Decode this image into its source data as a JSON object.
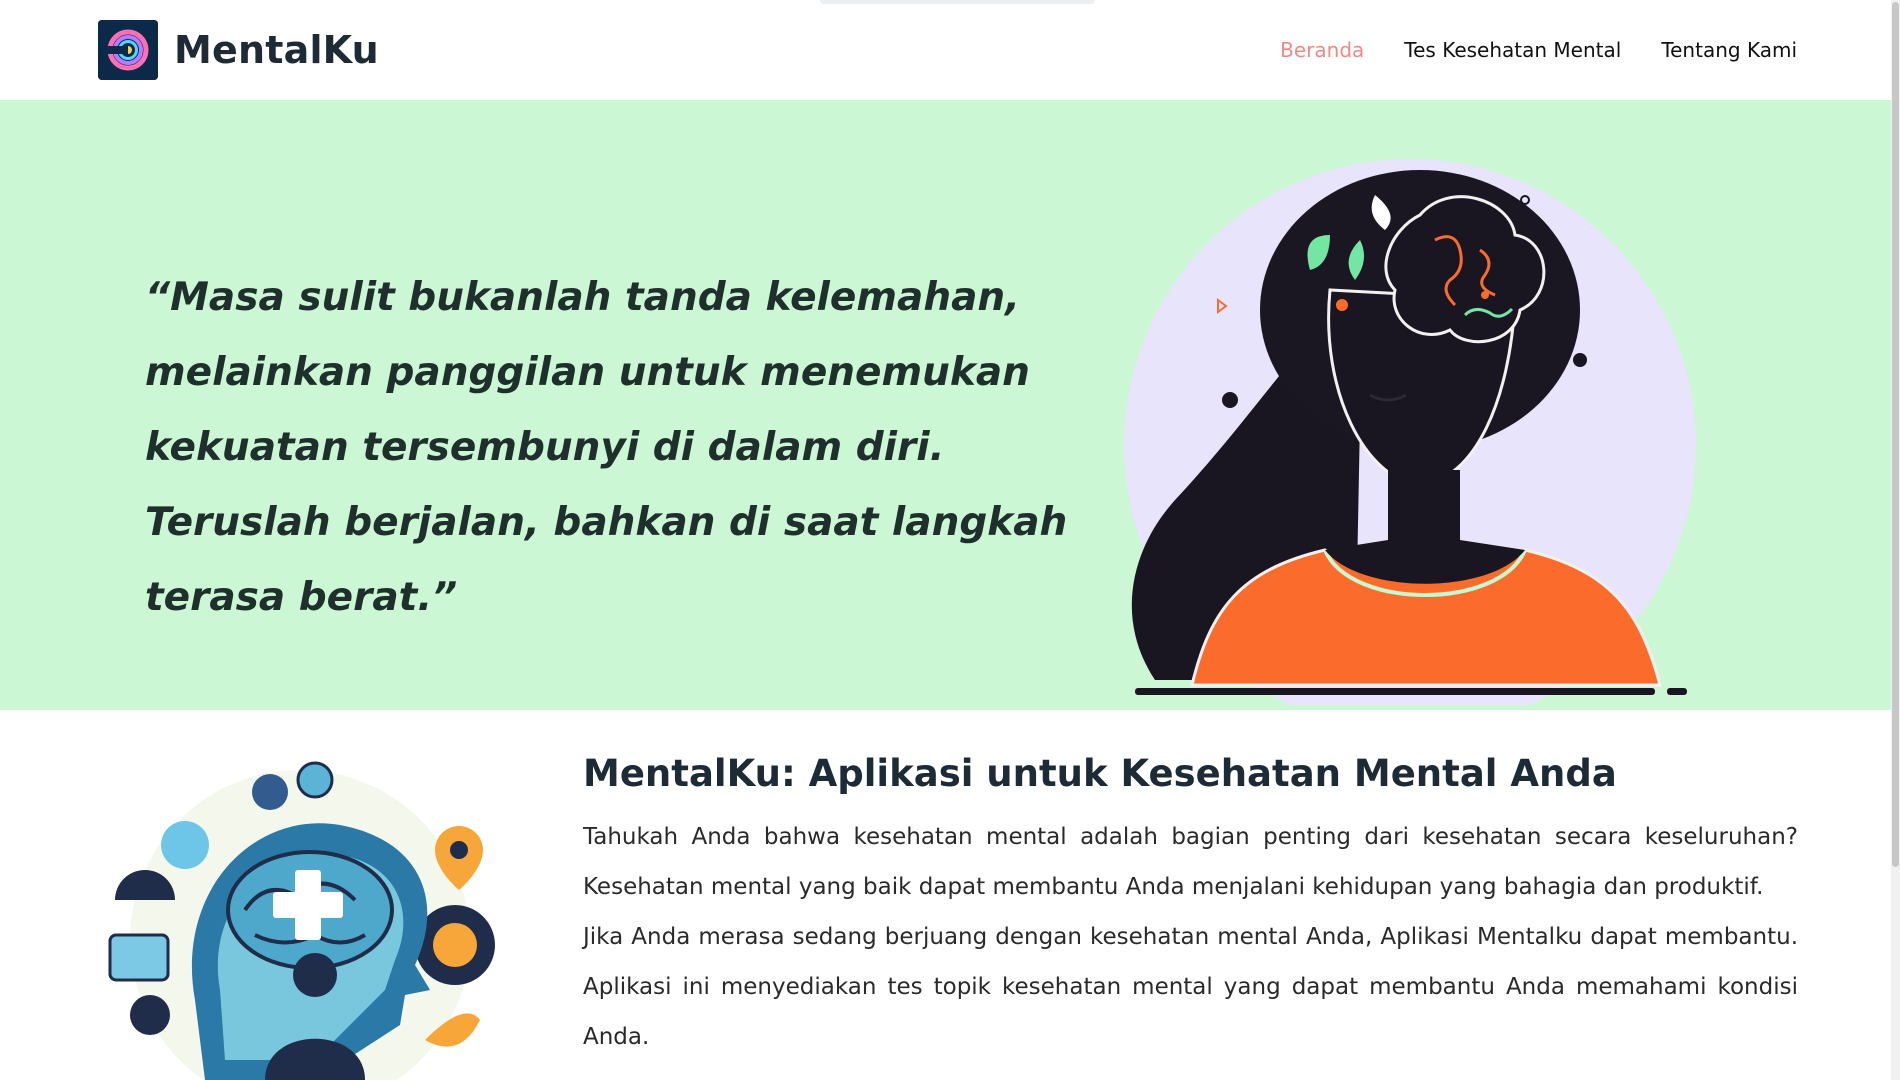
{
  "brand": {
    "name": "MentalKu"
  },
  "nav": {
    "items": [
      {
        "label": "Beranda",
        "active": true
      },
      {
        "label": "Tes Kesehatan Mental",
        "active": false
      },
      {
        "label": "Tentang Kami",
        "active": false
      }
    ]
  },
  "hero": {
    "quote": "“Masa sulit bukanlah tanda kelemahan, melainkan panggilan untuk menemukan kekuatan tersembunyi di dalam diri. Teruslah berjalan, bahkan di saat langkah terasa berat.”"
  },
  "intro": {
    "title": "MentalKu: Aplikasi untuk Kesehatan Mental Anda",
    "paragraph1": "Tahukah Anda bahwa kesehatan mental adalah bagian penting dari kesehatan secara keseluruhan? Kesehatan mental yang baik dapat membantu Anda menjalani kehidupan yang bahagia dan produktif.",
    "paragraph2": "Jika Anda merasa sedang berjuang dengan kesehatan mental Anda, Aplikasi Mentalku dapat membantu. Aplikasi ini menyediakan tes topik kesehatan mental yang dapat membantu Anda memahami kondisi Anda."
  },
  "colors": {
    "hero_bg": "#ccf7d5",
    "nav_active": "#ee8a86",
    "logo_bg": "#0b2a4a",
    "shirt": "#fb6c2c",
    "circle": "#e7e4fb"
  },
  "icons": {
    "logo": "brand-logo-icon",
    "hero": "woman-mind-illustration",
    "intro": "head-health-illustration"
  }
}
